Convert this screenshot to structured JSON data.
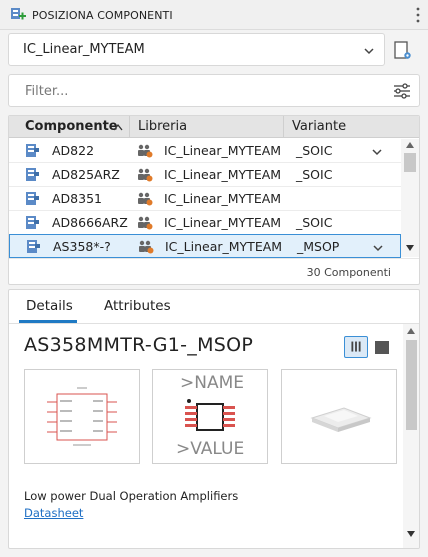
{
  "panel": {
    "title": "POSIZIONA COMPONENTI"
  },
  "library_select": {
    "value": "IC_Linear_MYTEAM"
  },
  "filter": {
    "placeholder": "Filter..."
  },
  "table": {
    "headers": [
      "Componente",
      "Libreria",
      "Variante"
    ],
    "sort_column": "Componente",
    "rows": [
      {
        "component": "AD822",
        "library": "IC_Linear_MYTEAM",
        "variant": "_SOIC",
        "has_dropdown": true,
        "selected": false
      },
      {
        "component": "AD825ARZ",
        "library": "IC_Linear_MYTEAM",
        "variant": "_SOIC",
        "has_dropdown": false,
        "selected": false
      },
      {
        "component": "AD8351",
        "library": "IC_Linear_MYTEAM",
        "variant": "",
        "has_dropdown": false,
        "selected": false
      },
      {
        "component": "AD8666ARZ",
        "library": "IC_Linear_MYTEAM",
        "variant": "_SOIC",
        "has_dropdown": false,
        "selected": false
      },
      {
        "component": "AS358*-?",
        "library": "IC_Linear_MYTEAM",
        "variant": "_MSOP",
        "has_dropdown": true,
        "selected": true
      }
    ],
    "count_label": "30 Componenti"
  },
  "details": {
    "tabs": [
      "Details",
      "Attributes"
    ],
    "active_tab": "Details",
    "part_name": "AS358MMTR-G1-_MSOP",
    "package_preview": {
      "name_label": ">NAME",
      "value_label": ">VALUE"
    },
    "description": "Low power Dual Operation Amplifiers",
    "datasheet_link": "Datasheet"
  },
  "colors": {
    "accent": "#1f7ac4",
    "selection_bg": "#e2f0fb",
    "pin_red": "#d9534f"
  },
  "icons": [
    "add-component-icon",
    "more-vertical-icon",
    "chevron-down-icon",
    "library-settings-icon",
    "filter-sliders-icon",
    "sort-up-icon",
    "component-icon",
    "library-icon",
    "grid-view-icon",
    "single-view-icon"
  ]
}
